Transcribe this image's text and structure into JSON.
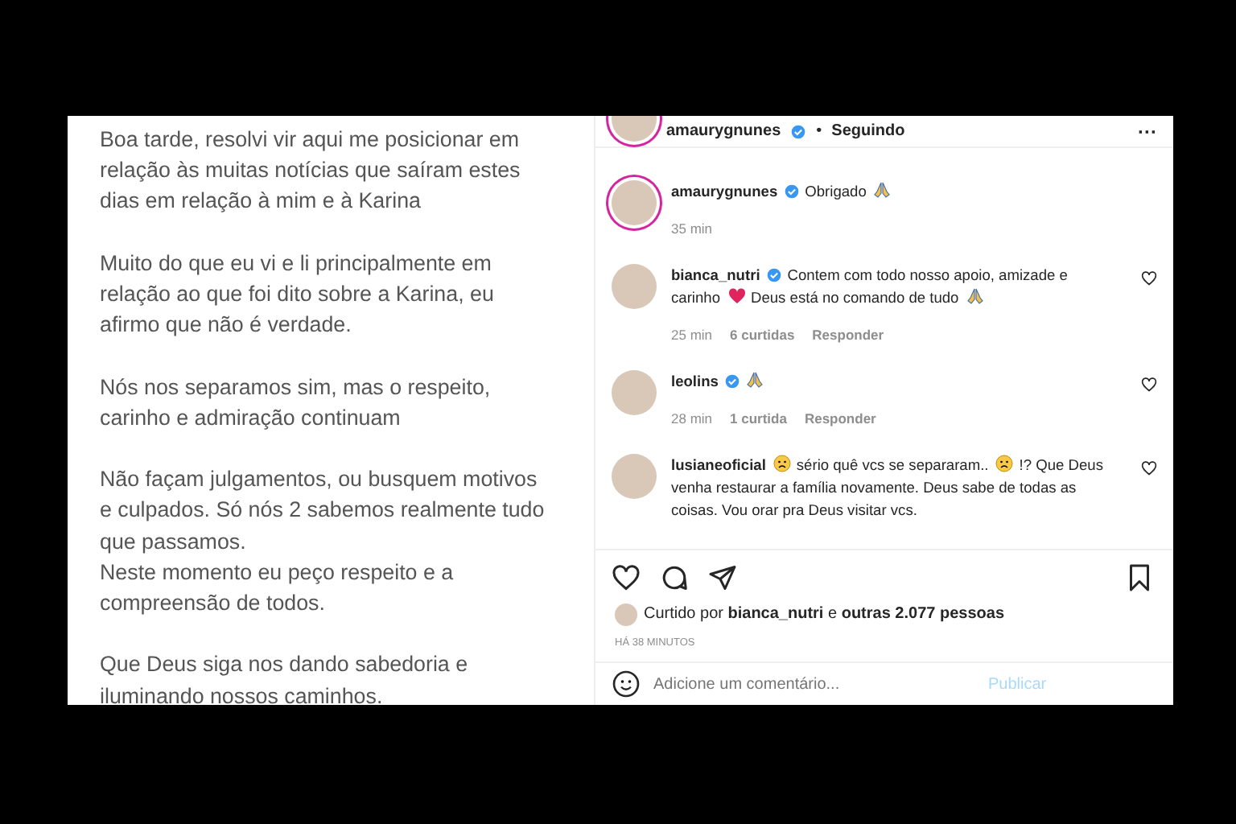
{
  "post_image": {
    "paragraphs": [
      [
        "Boa tarde, resolvi vir aqui me posicionar em",
        "relação às muitas notícias que saíram estes",
        "dias em relação à mim e à Karina"
      ],
      [
        "Muito do que eu vi e li principalmente em",
        "relação ao que foi dito sobre a Karina, eu",
        "afirmo que não é verdade."
      ],
      [
        "Nós nos separamos sim, mas o respeito,",
        "carinho e admiração continuam"
      ],
      [
        "Não façam julgamentos, ou busquem motivos",
        "e culpados. Só nós 2 sabemos realmente tudo",
        "que passamos.",
        "Neste momento eu peço respeito e a",
        "compreensão de todos."
      ],
      [
        "Que Deus siga nos dando sabedoria e",
        "iluminando nossos caminhos."
      ]
    ]
  },
  "header": {
    "username": "amaurygnunes",
    "verified": true,
    "separator": "•",
    "follow": "Seguindo",
    "more": "···"
  },
  "comments": [
    {
      "username": "amaurygnunes",
      "verified": true,
      "story_ring": true,
      "likeable": false,
      "lines": [
        [
          {
            "kind": "text",
            "text": "Obrigado"
          },
          {
            "kind": "pray"
          }
        ]
      ],
      "time": "35 min"
    },
    {
      "username": "bianca_nutri",
      "verified": true,
      "story_ring": false,
      "likeable": true,
      "lines": [
        [
          {
            "kind": "text",
            "text": "Contem com todo nosso apoio, amizade e"
          }
        ],
        [
          {
            "kind": "text",
            "text": "carinho"
          },
          {
            "kind": "heart"
          },
          {
            "kind": "text",
            "text": "Deus está no comando de tudo"
          },
          {
            "kind": "pray"
          }
        ]
      ],
      "time": "25 min",
      "likes": "6 curtidas",
      "reply": "Responder"
    },
    {
      "username": "leolins",
      "verified": true,
      "story_ring": false,
      "likeable": true,
      "lines": [
        [
          {
            "kind": "pray"
          }
        ]
      ],
      "time": "28 min",
      "likes": "1 curtida",
      "reply": "Responder"
    },
    {
      "username": "lusianeoficial",
      "verified": false,
      "story_ring": false,
      "likeable": true,
      "lines": [
        [
          {
            "kind": "sad"
          },
          {
            "kind": "text",
            "text": "sério quê vcs se separaram.."
          },
          {
            "kind": "sad"
          },
          {
            "kind": "text",
            "text": "!? Que Deus"
          }
        ],
        [
          {
            "kind": "text",
            "text": "venha restaurar a família novamente. Deus sabe de todas as"
          }
        ],
        [
          {
            "kind": "text",
            "text": "coisas. Vou orar pra Deus visitar vcs."
          }
        ]
      ]
    }
  ],
  "likes_line": {
    "prefix": "Curtido por",
    "user": "bianca_nutri",
    "joiner": "e",
    "others": "outras 2.077 pessoas"
  },
  "post_time": "HÁ 38 MINUTOS",
  "comment_box": {
    "placeholder": "Adicione um comentário...",
    "button": "Publicar",
    "disabled": true
  }
}
